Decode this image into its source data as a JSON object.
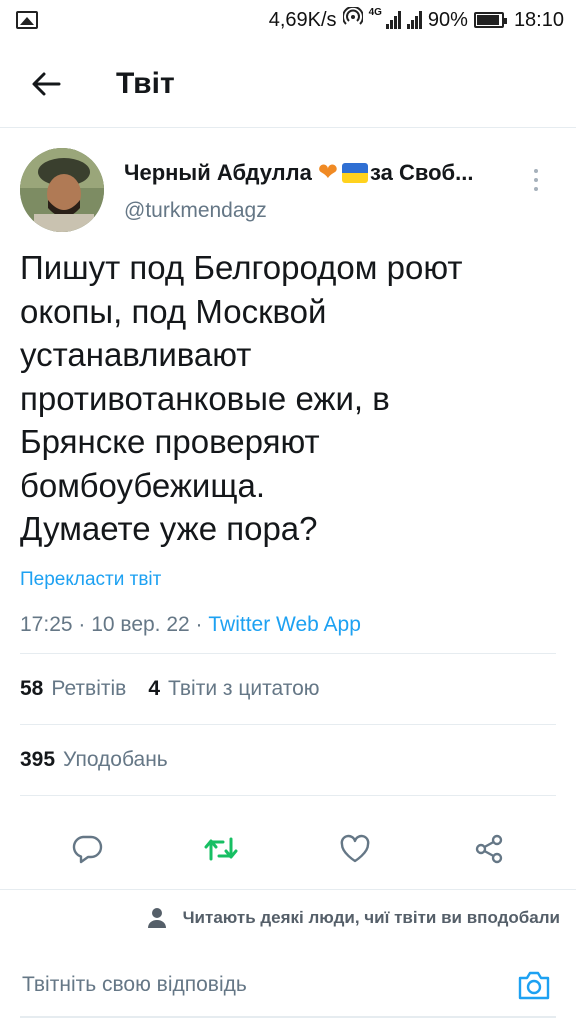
{
  "status_bar": {
    "speed": "4,69K/s",
    "network": "4G",
    "battery": "90%",
    "time": "18:10"
  },
  "header": {
    "title": "Твіт"
  },
  "tweet": {
    "display_name": "Черный Абдулла",
    "display_name_suffix": "за Своб...",
    "handle": "@turkmendagz",
    "text": "Пишут под Белгородом роют\nокопы, под Москвой\nустанавливают\nпротивотанковые ежи, в\nБрянске проверяют\nбомбоубежища.\nДумаете уже пора?",
    "translate_label": "Перекласти твіт",
    "timestamp": "17:25 · 10 вер. 22 · ",
    "source_app": "Twitter Web App"
  },
  "stats": {
    "retweets_count": "58",
    "retweets_label": "Ретвітів",
    "quotes_count": "4",
    "quotes_label": "Твіти з цитатою",
    "likes_count": "395",
    "likes_label": "Уподобань"
  },
  "notice": {
    "text": "Читають деякі люди, чиї твіти ви вподобали"
  },
  "reply": {
    "placeholder": "Твітніть свою відповідь"
  },
  "colors": {
    "accent": "#1da1f2",
    "retweet_active": "#17bf63",
    "muted": "#657786",
    "divider": "#e6ecf0"
  },
  "icons": {
    "back": "arrow-left-icon",
    "more": "more-vertical-icon",
    "reply": "comment-icon",
    "retweet": "retweet-icon",
    "like": "heart-icon",
    "share": "share-icon",
    "person": "person-icon",
    "camera": "camera-icon"
  }
}
